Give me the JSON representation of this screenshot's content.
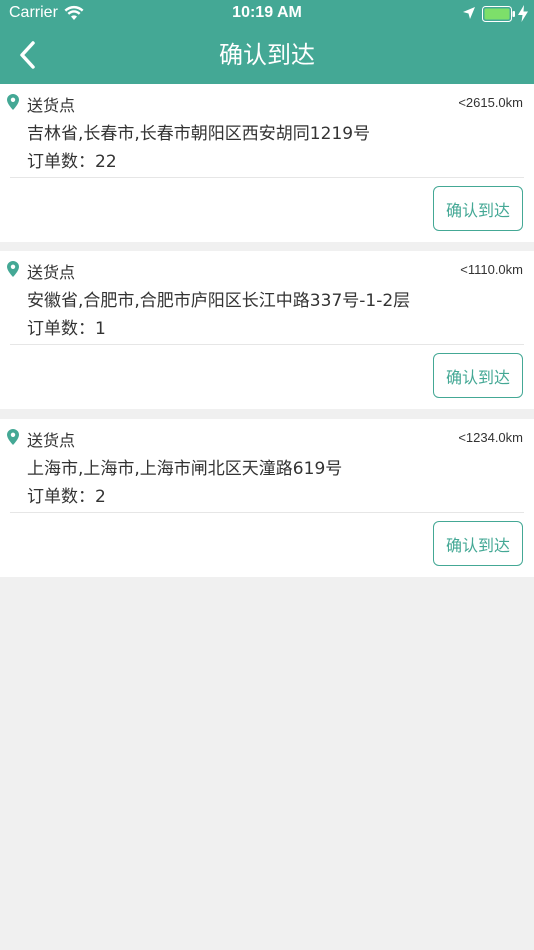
{
  "status_bar": {
    "carrier": "Carrier",
    "time": "10:19 AM"
  },
  "nav": {
    "title": "确认到达",
    "back_icon": "chevron-left-icon"
  },
  "colors": {
    "accent": "#44a895",
    "background": "#f0f0f0",
    "card": "#ffffff",
    "text": "#333333"
  },
  "deliveries": [
    {
      "point_label": "送货点",
      "distance": "<2615.0km",
      "address": "吉林省,长春市,长春市朝阳区西安胡同1219号",
      "orders_label": "订单数：",
      "orders_count": "22",
      "confirm_label": "确认到达"
    },
    {
      "point_label": "送货点",
      "distance": "<1110.0km",
      "address": "安徽省,合肥市,合肥市庐阳区长江中路337号-1-2层",
      "orders_label": "订单数：",
      "orders_count": "1",
      "confirm_label": "确认到达"
    },
    {
      "point_label": "送货点",
      "distance": "<1234.0km",
      "address": "上海市,上海市,上海市闸北区天潼路619号",
      "orders_label": "订单数：",
      "orders_count": "2",
      "confirm_label": "确认到达"
    }
  ]
}
